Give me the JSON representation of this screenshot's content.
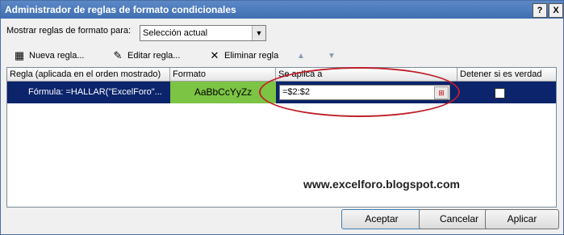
{
  "window": {
    "title": "Administrador de reglas de formato condicionales",
    "help": "?",
    "close": "X"
  },
  "filter": {
    "label": "Mostrar reglas de formato para:",
    "value": "Selección actual"
  },
  "toolbar": {
    "new_label": "Nueva regla...",
    "edit_label": "Editar regla...",
    "delete_label": "Eliminar regla"
  },
  "grid": {
    "headers": [
      "Regla (aplicada en el orden mostrado)",
      "Formato",
      "Se aplica a",
      "Detener si es verdad"
    ],
    "rows": [
      {
        "rule": "Fórmula: =HALLAR(\"ExcelForo\"...",
        "format": "AaBbCcYyZz",
        "applies_to": "=$2:$2",
        "stop": false
      }
    ]
  },
  "watermark": "www.excelforo.blogspot.com",
  "buttons": {
    "accept": "Aceptar",
    "cancel": "Cancelar",
    "apply": "Aplicar"
  },
  "colors": {
    "selection": "#0b246b",
    "format_preview": "#7cc444",
    "annotation": "#c0202a"
  }
}
